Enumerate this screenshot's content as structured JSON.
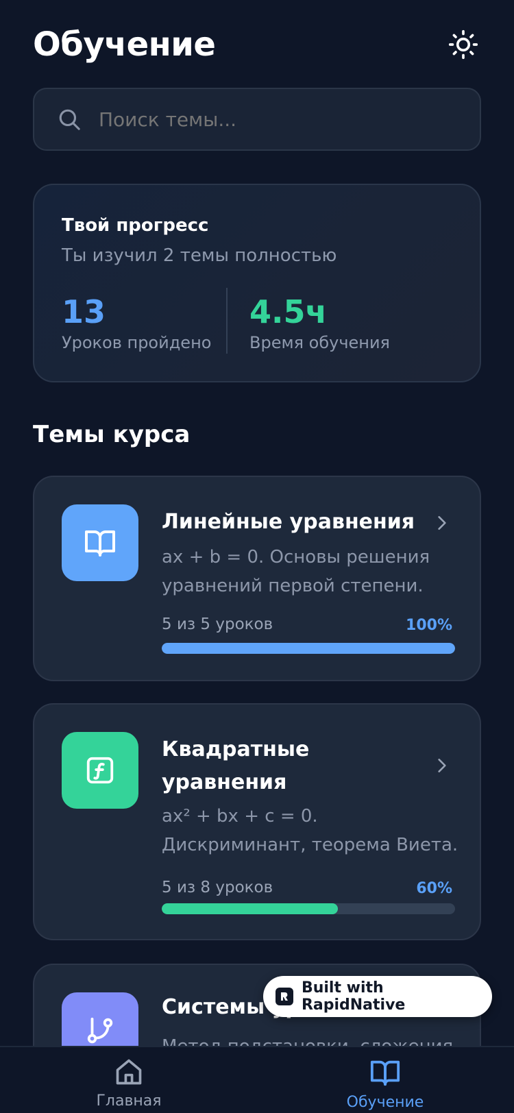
{
  "header": {
    "title": "Обучение",
    "theme_icon": "sun-icon"
  },
  "search": {
    "placeholder": "Поиск темы...",
    "icon": "search-icon"
  },
  "progress": {
    "title": "Твой прогресс",
    "subtitle": "Ты изучил 2 темы полностью",
    "stats": [
      {
        "value": "13",
        "label": "Уроков пройдено",
        "color": "#5aa0f7"
      },
      {
        "value": "4.5ч",
        "label": "Время обучения",
        "color": "#34d399"
      }
    ]
  },
  "section": {
    "title": "Темы курса"
  },
  "topics": [
    {
      "title": "Линейные уравнения",
      "description": "ax + b = 0. Основы решения уравнений первой степени.",
      "lessons": "5 из 5 уроков",
      "percent": "100%",
      "progress": 1.0,
      "icon": "book-icon",
      "color": "#60a5fa"
    },
    {
      "title": "Квадратные уравнения",
      "description": "ax² + bx + c = 0. Дискриминант, теорема Виета.",
      "lessons": "5 из 8 уроков",
      "percent": "60%",
      "progress": 0.6,
      "icon": "function-icon",
      "color": "#34d399"
    },
    {
      "title": "Системы уравнений",
      "description": "Метод подстановки, сложения",
      "icon": "git-branch-icon",
      "color": "#818cf8"
    }
  ],
  "nav": [
    {
      "label": "Главная",
      "icon": "home-icon",
      "active": false
    },
    {
      "label": "Обучение",
      "icon": "book-open-icon",
      "active": true
    }
  ],
  "badge": {
    "text": "Built with RapidNative"
  },
  "colors": {
    "background": "#0e1628",
    "card": "#1e293b",
    "accent_blue": "#5aa0f7",
    "accent_green": "#34d399",
    "track": "#334155"
  }
}
